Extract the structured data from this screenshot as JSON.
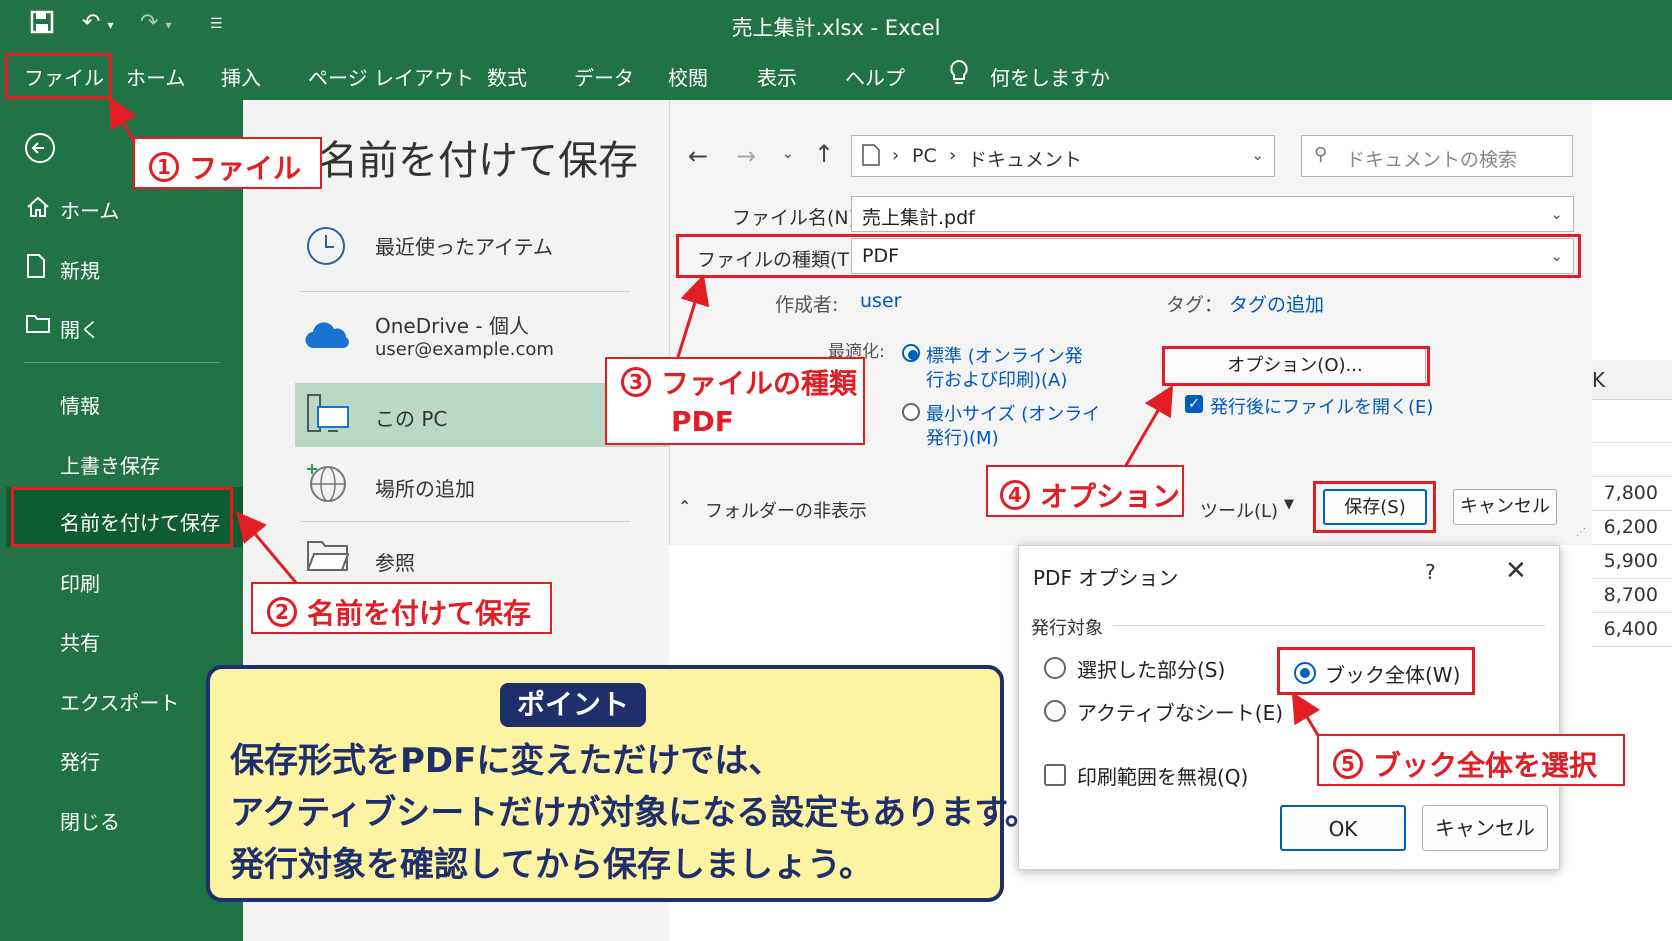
{
  "window": {
    "title": "売上集計.xlsx  -  Excel"
  },
  "menu": {
    "items": [
      "ファイル",
      "ホーム",
      "挿入",
      "ページ レイアウト",
      "数式",
      "データ",
      "校閲",
      "表示",
      "ヘルプ"
    ],
    "tell_me": "何をしますか"
  },
  "sidebar": {
    "home": "ホーム",
    "new": "新規",
    "open": "開く",
    "info": "情報",
    "overwrite": "上書き保存",
    "save_as": "名前を付けて保存",
    "print": "印刷",
    "share": "共有",
    "export": "エクスポート",
    "publish": "発行",
    "close": "閉じる"
  },
  "backstage": {
    "title": "名前を付けて保存",
    "recent": "最近使ったアイテム",
    "onedrive": "OneDrive - 個人",
    "onedrive_email": "user@example.com",
    "this_pc": "この PC",
    "add_place": "場所の追加",
    "browse": "参照"
  },
  "save_dialog": {
    "path": [
      "PC",
      "ドキュメント"
    ],
    "search_placeholder": "ドキュメントの検索",
    "filename_label": "ファイル名(N):",
    "filename_value": "売上集計.pdf",
    "filetype_label": "ファイルの種類(T):",
    "filetype_value": "PDF",
    "author_label": "作成者:",
    "author_value": "user",
    "tags_label": "タグ：",
    "tags_value": "タグの追加",
    "optimize_label": "最適化:",
    "opt_standard_1": "標準 (オンライン発",
    "opt_standard_2": "行および印刷)(A)",
    "opt_min_1": "最小サイズ (オンライ",
    "opt_min_2": "発行)(M)",
    "options_button": "オプション(O)...",
    "open_after": "発行後にファイルを開く(E)",
    "hide_folders": "フォルダーの非表示",
    "tools": "ツール(L)",
    "save": "保存(S)",
    "cancel": "キャンセル"
  },
  "sheet": {
    "col_header": "K",
    "values": [
      "7,800",
      "6,200",
      "5,900",
      "8,700",
      "6,400"
    ]
  },
  "pdf_options": {
    "title": "PDF オプション",
    "help": "?",
    "section": "発行対象",
    "opt_selection": "選択した部分(S)",
    "opt_active_sheet": "アクティブなシート(E)",
    "opt_whole_book": "ブック全体(W)",
    "ignore_print_area": "印刷範囲を無視(Q)",
    "ok": "OK",
    "cancel": "キャンセル"
  },
  "callouts": {
    "c1_num": "1",
    "c1_text": "ファイル",
    "c2_num": "2",
    "c2_text": "名前を付けて保存",
    "c3_num": "3",
    "c3_text_1": "ファイルの種類",
    "c3_text_2": "PDF",
    "c4_num": "4",
    "c4_text": "オプション",
    "c5_num": "5",
    "c5_text": "ブック全体を選択"
  },
  "point": {
    "badge": "ポイント",
    "lines": [
      "保存形式をPDFに変えただけでは、",
      "アクティブシートだけが対象になる設定もあります。",
      "発行対象を確認してから保存しましょう。"
    ]
  },
  "colors": {
    "excel_green": "#217346",
    "callout_red": "#e01e24",
    "point_navy": "#1f2f6b",
    "point_yellow": "#fcf3a3"
  }
}
